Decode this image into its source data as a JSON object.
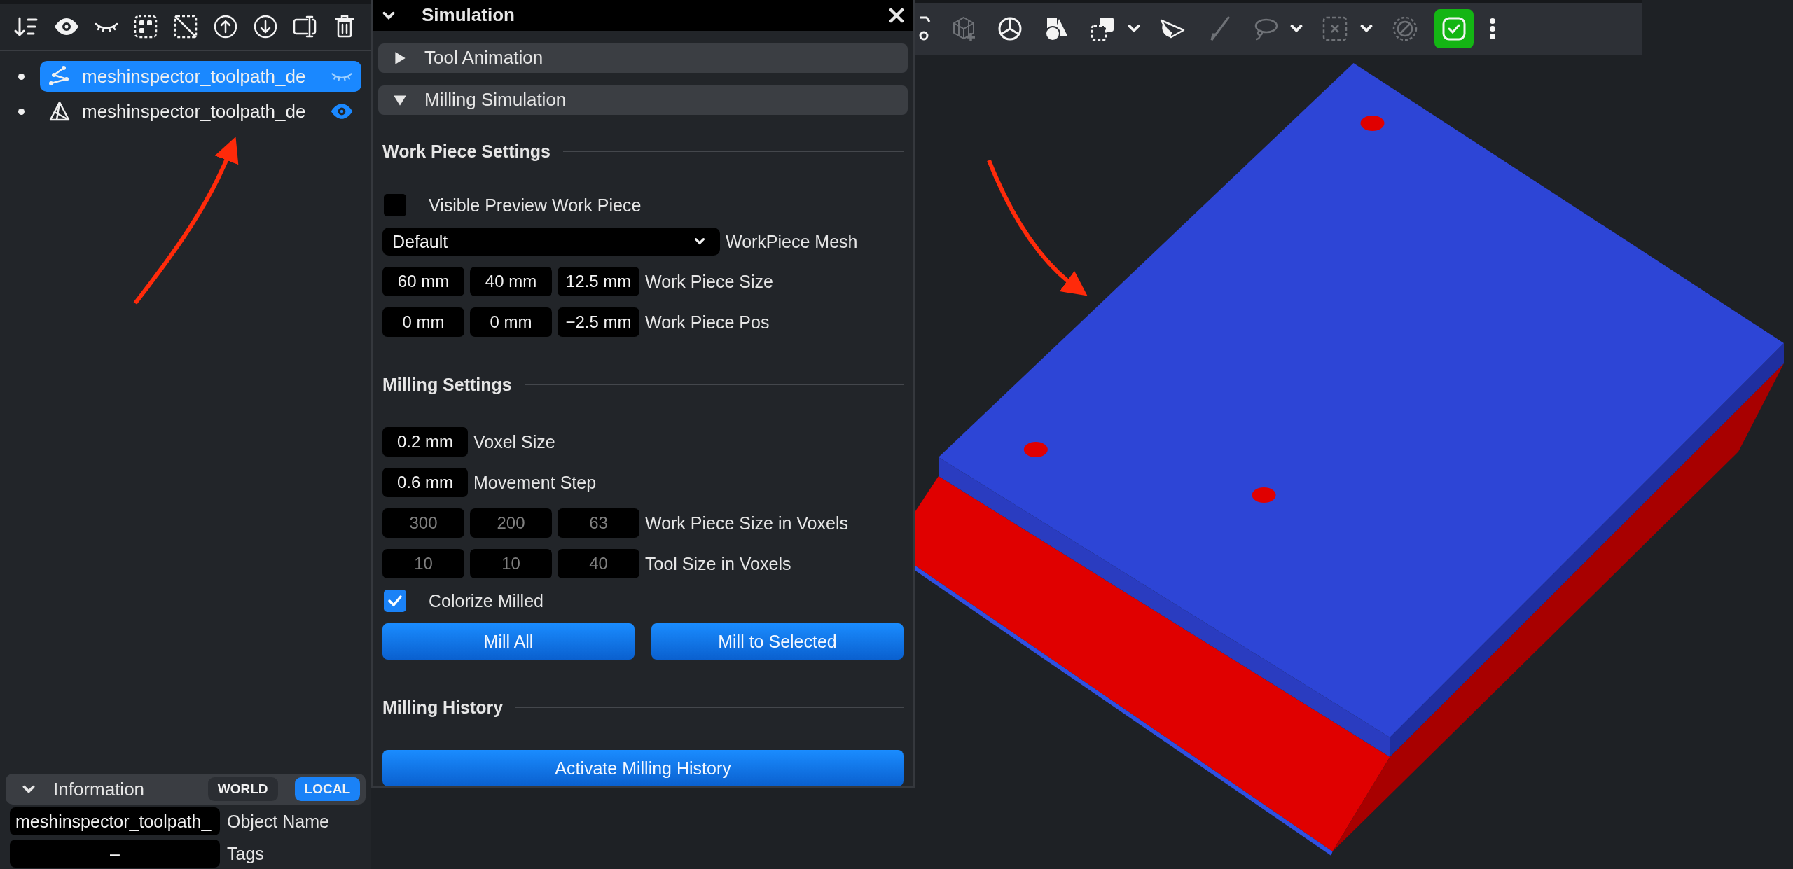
{
  "tree": [
    {
      "kind": "toolpath",
      "label": "meshinspector_toolpath_de",
      "selected": true,
      "visible": false
    },
    {
      "kind": "mesh",
      "label": "meshinspector_toolpath_de",
      "selected": false,
      "visible": true
    }
  ],
  "information": {
    "title": "Information",
    "expanded": true,
    "toggles": [
      {
        "label": "WORLD",
        "selected": false
      },
      {
        "label": "LOCAL",
        "selected": true
      }
    ],
    "fields": [
      {
        "value": "meshinspector_toolpath_",
        "label": "Object Name"
      },
      {
        "value": "–",
        "label": "Tags"
      }
    ]
  },
  "simulation": {
    "title": "Simulation",
    "expanded": true,
    "sections": [
      {
        "title": "Tool Animation",
        "expanded": false
      },
      {
        "title": "Milling Simulation",
        "expanded": true
      }
    ],
    "rows": [
      {
        "kind": "heading",
        "text": "Work Piece Settings"
      },
      {
        "kind": "checkbox",
        "label": "Visible Preview Work Piece",
        "checked": false
      },
      {
        "kind": "dropdown",
        "selection": "Default",
        "label": "WorkPiece Mesh"
      },
      {
        "kind": "fields",
        "values": [
          "60 mm",
          "40 mm",
          "12.5 mm"
        ],
        "label": "Work Piece Size",
        "disabled": false
      },
      {
        "kind": "fields",
        "values": [
          "0 mm",
          "0 mm",
          "−2.5 mm"
        ],
        "label": "Work Piece Pos",
        "disabled": false
      },
      {
        "kind": "heading",
        "text": "Milling Settings"
      },
      {
        "kind": "fields",
        "values": [
          "0.2 mm"
        ],
        "label": "Voxel Size",
        "disabled": false
      },
      {
        "kind": "fields",
        "values": [
          "0.6 mm"
        ],
        "label": "Movement Step",
        "disabled": false
      },
      {
        "kind": "fields",
        "values": [
          "300",
          "200",
          "63"
        ],
        "label": "Work Piece Size in Voxels",
        "disabled": true
      },
      {
        "kind": "fields",
        "values": [
          "10",
          "10",
          "40"
        ],
        "label": "Tool Size in Voxels",
        "disabled": true
      },
      {
        "kind": "checkbox",
        "label": "Colorize Milled",
        "checked": true
      },
      {
        "kind": "buttons",
        "buttons": [
          "Mill All",
          "Mill to Selected"
        ]
      },
      {
        "kind": "heading",
        "text": "Milling History"
      },
      {
        "kind": "buttons",
        "buttons": [
          "Activate Milling History"
        ]
      }
    ]
  },
  "viewport_toolbar": [
    {
      "disabled": false,
      "dropdown": false,
      "selected": false
    },
    {
      "disabled": true,
      "dropdown": false,
      "selected": false
    },
    {
      "disabled": false,
      "dropdown": false,
      "selected": false
    },
    {
      "disabled": false,
      "dropdown": false,
      "selected": false
    },
    {
      "disabled": false,
      "dropdown": true,
      "selected": false
    },
    {
      "disabled": false,
      "dropdown": false,
      "selected": false
    },
    {
      "disabled": true,
      "dropdown": false,
      "selected": false
    },
    {
      "disabled": true,
      "dropdown": true,
      "selected": false
    },
    {
      "disabled": true,
      "dropdown": true,
      "selected": false
    },
    {
      "disabled": true,
      "dropdown": false,
      "selected": false
    },
    {
      "disabled": false,
      "dropdown": false,
      "selected": true
    },
    {
      "disabled": false,
      "dropdown": false,
      "selected": false
    }
  ]
}
